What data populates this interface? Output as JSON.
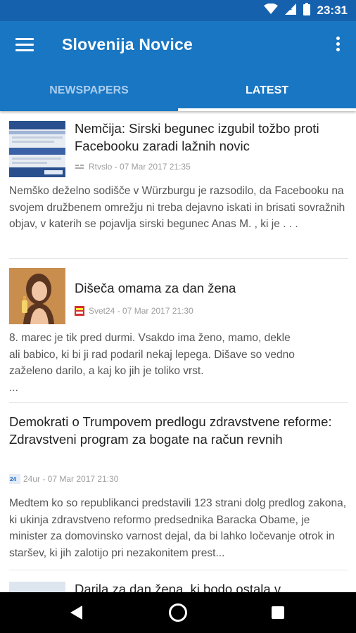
{
  "status_bar": {
    "time": "23:31"
  },
  "app_bar": {
    "title": "Slovenija Novice"
  },
  "tabs": [
    {
      "label": "NEWSPAPERS",
      "selected": false
    },
    {
      "label": "LATEST",
      "selected": true
    }
  ],
  "articles": [
    {
      "headline": "Nemčija: Sirski begunec izgubil tožbo proti Facebooku zaradi lažnih novic",
      "source": "Rtvslo - 07 Mar 2017 21:35",
      "excerpt": "Nemško deželno sodišče v Würzburgu je razsodilo, da Facebooku na svojem družbenem omrežju ni treba dejavno iskati in brisati sovražnih objav, v katerih se pojavlja sirski begunec Anas M. , ki je . . ."
    },
    {
      "headline": "Dišeča omama za dan žena",
      "source": "Svet24 - 07 Mar 2017 21:30",
      "excerpt_lines": [
        "8. marec je tik pred durmi. Vsakdo ima ženo, mamo, dekle",
        "ali babico, ki bi ji rad podaril nekaj lepega. Dišave so vedno",
        "zaželeno darilo, a kaj ko jih je toliko vrst.",
        "..."
      ]
    },
    {
      "headline": "Demokrati o Trumpovem predlogu zdravstvene reforme: Zdravstveni program za bogate na račun revnih",
      "source": "24ur - 07 Mar 2017 21:30",
      "excerpt": "Medtem ko so republikanci predstavili 123 strani dolg predlog zakona, ki ukinja zdravstveno reformo predsednika Baracka Obame, je minister za domovinsko varnost dejal, da bi lahko ločevanje otrok in staršev, ki jih zalotijo pri nezakonitem prest..."
    },
    {
      "headline": "Darila za dan žena, ki bodo ostala v"
    }
  ],
  "colors": {
    "status_bar": "#1561ad",
    "app_bar": "#1976c2",
    "tab_inactive": "#a9cdef"
  }
}
